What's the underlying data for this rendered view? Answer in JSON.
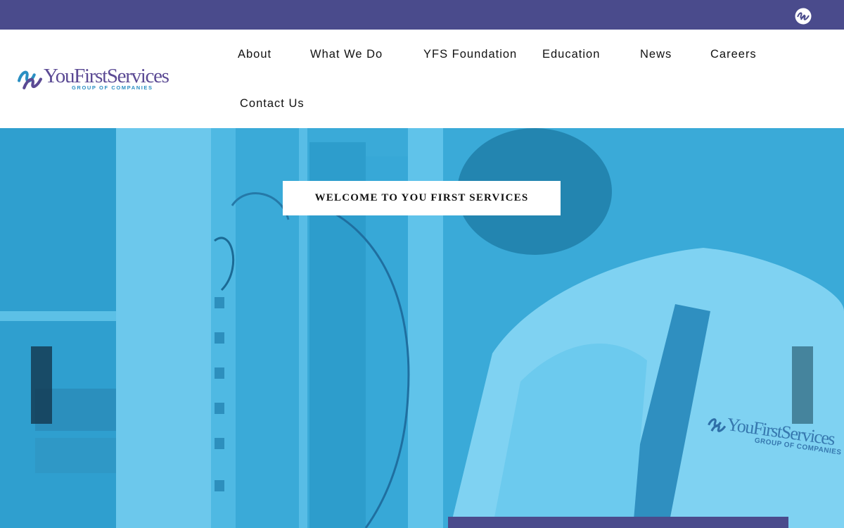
{
  "brand": {
    "name": "YouFirstServices",
    "tagline": "GROUP OF COMPANIES",
    "icon": "yfs-swirl-logo-icon",
    "colors": {
      "purple": "#4a4b8c",
      "logo_purple": "#5b4a94",
      "logo_blue": "#2a8fc2",
      "hero_blue": "#3aaad8"
    }
  },
  "nav": {
    "items": [
      {
        "label": "About"
      },
      {
        "label": "What We Do"
      },
      {
        "label": "YFS Foundation"
      },
      {
        "label": "Education"
      },
      {
        "label": "News"
      },
      {
        "label": "Careers"
      },
      {
        "label": "Contact Us"
      }
    ]
  },
  "hero": {
    "welcome": "WELCOME TO YOU FIRST SERVICES",
    "coat_brand": "YouFirstServices",
    "coat_tagline": "GROUP OF COMPANIES",
    "prev_icon": "slider-prev-arrow-icon",
    "next_icon": "slider-next-arrow-icon"
  }
}
